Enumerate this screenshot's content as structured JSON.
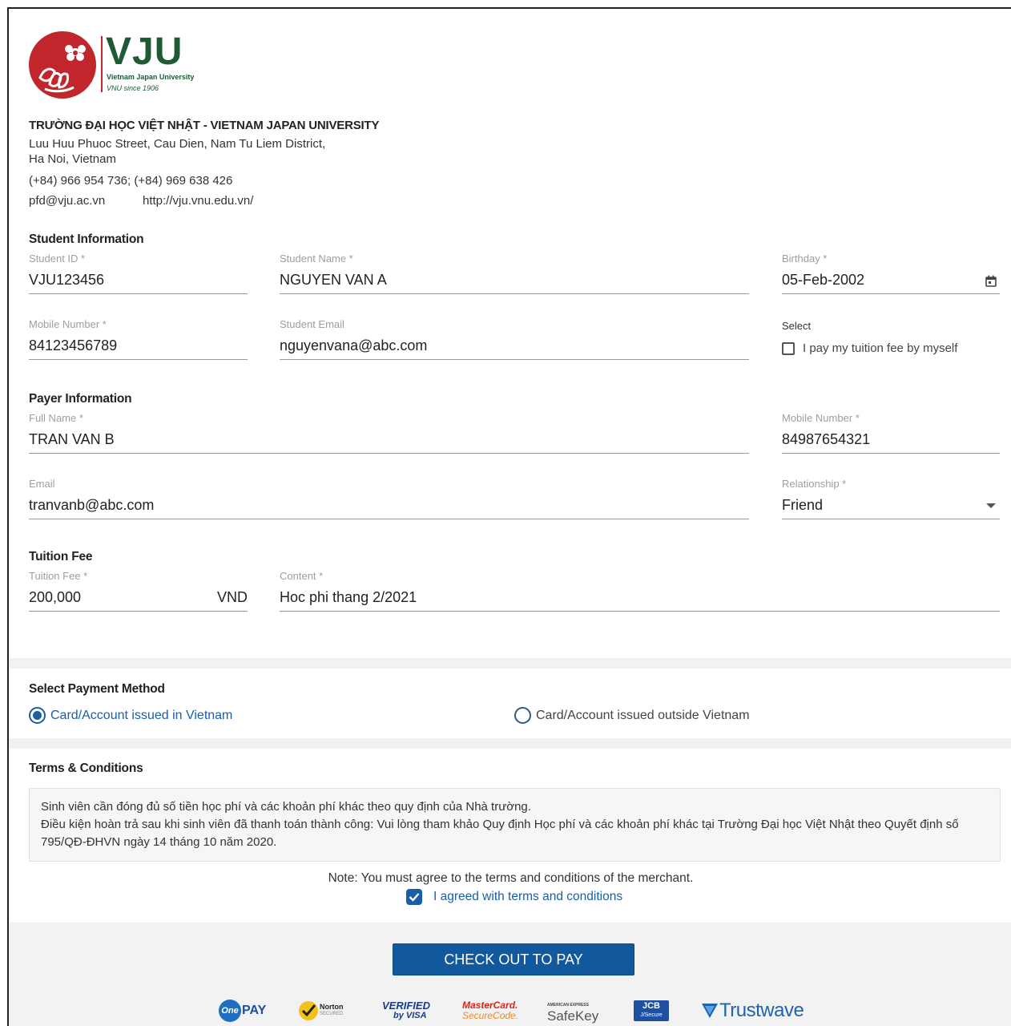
{
  "brand": {
    "short_name": "VJU",
    "full_name_en": "Vietnam Japan University",
    "tagline": "VNU since 1906",
    "primary_color": "#c0262c",
    "green_color": "#1f5a35",
    "accent_color": "#1a5ea8"
  },
  "university": {
    "name": "TRƯỜNG ĐẠI HỌC VIỆT NHẬT - VIETNAM JAPAN UNIVERSITY",
    "address_line1": "Luu Huu Phuoc Street, Cau Dien, Nam Tu Liem District,",
    "address_line2": "Ha Noi, Vietnam",
    "phone": "(+84) 966 954 736; (+84) 969 638 426",
    "email": "pfd@vju.ac.vn",
    "website": "http://vju.vnu.edu.vn/"
  },
  "student": {
    "section_title": "Student Information",
    "id_label": "Student ID *",
    "id_value": "VJU123456",
    "name_label": "Student Name *",
    "name_value": "NGUYEN VAN A",
    "birthday_label": "Birthday *",
    "birthday_value": "05-Feb-2002",
    "mobile_label": "Mobile Number *",
    "mobile_value": "84123456789",
    "email_label": "Student Email",
    "email_value": "nguyenvana@abc.com",
    "select_label": "Select",
    "self_pay_label": "I pay my tuition fee by myself",
    "self_pay_checked": false
  },
  "payer": {
    "section_title": "Payer Information",
    "name_label": "Full Name *",
    "name_value": "TRAN VAN B",
    "mobile_label": "Mobile Number *",
    "mobile_value": "84987654321",
    "email_label": "Email",
    "email_value": "tranvanb@abc.com",
    "relationship_label": "Relationship *",
    "relationship_value": "Friend"
  },
  "tuition": {
    "section_title": "Tuition Fee",
    "fee_label": "Tuition Fee *",
    "fee_value": "200,000",
    "currency": "VND",
    "content_label": "Content *",
    "content_value": "Hoc phi thang 2/2021"
  },
  "payment_method": {
    "section_title": "Select Payment Method",
    "options": [
      {
        "label": "Card/Account issued in Vietnam",
        "selected": true
      },
      {
        "label": "Card/Account issued outside Vietnam",
        "selected": false
      }
    ]
  },
  "terms": {
    "section_title": "Terms & Conditions",
    "line1": "Sinh viên cần đóng đủ số tiền học phí và các khoản phí khác theo quy định của Nhà trường.",
    "line2": "Điều kiện hoàn trả sau khi sinh viên đã thanh toán thành công: Vui lòng tham khảo Quy định Học phí và các khoản phí khác tại Trường Đại học Việt Nhật theo Quyết định số 795/QĐ-ĐHVN ngày 14 tháng 10 năm 2020.",
    "note": "Note: You must agree to the terms and conditions of the merchant.",
    "agree_label": "I agreed with terms and conditions",
    "agree_checked": true
  },
  "checkout": {
    "button_label": "CHECK OUT TO PAY"
  },
  "partners": {
    "onepay": "PAY",
    "onepay_prefix": "One",
    "norton": "Norton",
    "norton_sub": "SECURED",
    "visa_top": "VERIFIED",
    "visa_bottom": "by VISA",
    "mc_top": "MasterCard.",
    "mc_bottom": "SecureCode.",
    "amex_top": "AMERICAN EXPRESS",
    "amex_bottom": "SafeKey",
    "jcb_top": "JCB",
    "jcb_bottom": "J/Secure",
    "trustwave": "Trustwave"
  }
}
